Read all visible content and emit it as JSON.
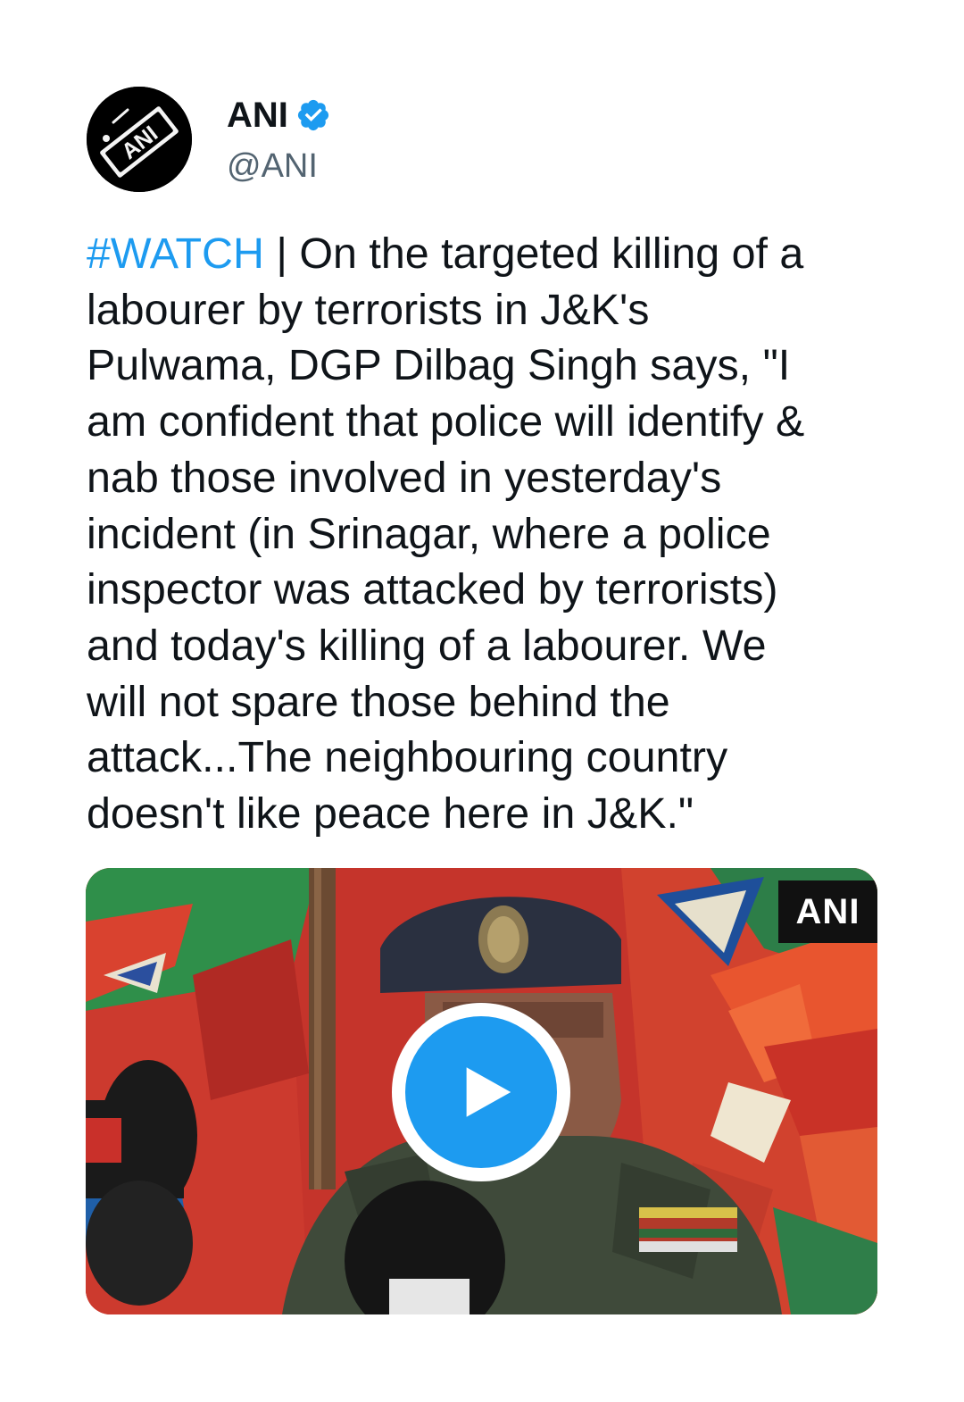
{
  "author": {
    "display_name": "ANI",
    "handle": "@ANI",
    "verified": true,
    "avatar_icon": "ani-logo-icon",
    "avatar_text": "ANI"
  },
  "tweet": {
    "hashtag": "#WATCH",
    "lines": [
      " | On the targeted killing of a",
      "labourer by terrorists in J&K's",
      "Pulwama, DGP Dilbag Singh says, \"I",
      "am confident that police will identify &",
      "nab those involved in yesterday's",
      "incident (in Srinagar, where a police",
      "inspector was attacked by terrorists)",
      "and today's killing of a labourer. We",
      "will not spare those behind the",
      "attack...The neighbouring country",
      "doesn't like peace here in J&K.\""
    ]
  },
  "media": {
    "type": "video",
    "watermark": "ANI",
    "play_icon": "play-icon"
  },
  "colors": {
    "link": "#1d9bf0",
    "text": "#0f1419",
    "secondary": "#536471",
    "play_button": "#1d9bf0"
  }
}
